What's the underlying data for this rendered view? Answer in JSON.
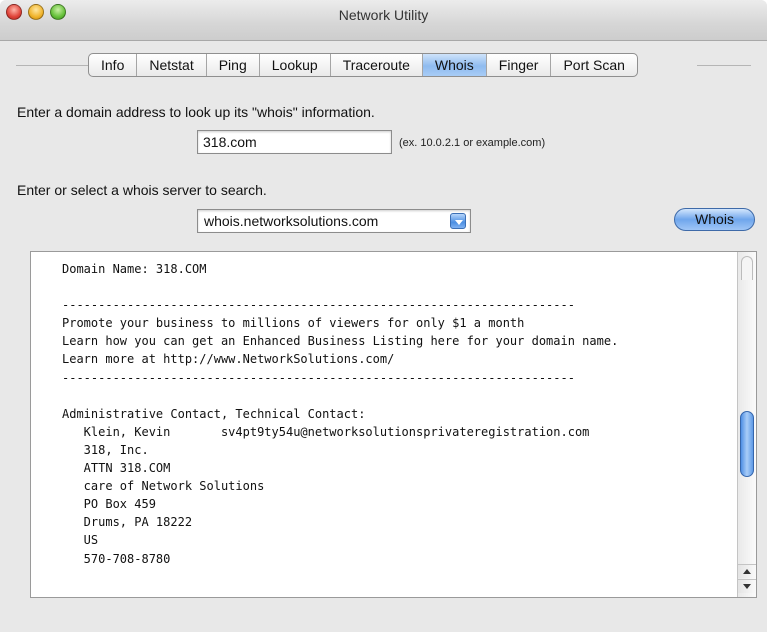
{
  "window": {
    "title": "Network Utility"
  },
  "tabs": [
    {
      "label": "Info"
    },
    {
      "label": "Netstat"
    },
    {
      "label": "Ping"
    },
    {
      "label": "Lookup"
    },
    {
      "label": "Traceroute"
    },
    {
      "label": "Whois",
      "active": true
    },
    {
      "label": "Finger"
    },
    {
      "label": "Port Scan"
    }
  ],
  "domain_prompt": "Enter a domain address to look up its \"whois\" information.",
  "domain_input": {
    "value": "318.com"
  },
  "domain_hint": "(ex. 10.0.2.1 or example.com)",
  "server_prompt": "Enter or select a whois server to search.",
  "server_select": {
    "value": "whois.networksolutions.com"
  },
  "whois_button": "Whois",
  "output_text": "Domain Name: 318.COM\n\n-----------------------------------------------------------------------\nPromote your business to millions of viewers for only $1 a month\nLearn how you can get an Enhanced Business Listing here for your domain name.\nLearn more at http://www.NetworkSolutions.com/\n-----------------------------------------------------------------------\n\nAdministrative Contact, Technical Contact:\n   Klein, Kevin       sv4pt9ty54u@networksolutionsprivateregistration.com\n   318, Inc.\n   ATTN 318.COM\n   care of Network Solutions\n   PO Box 459\n   Drums, PA 18222\n   US\n   570-708-8780",
  "scrollbar": {
    "position_fraction": 0.55
  },
  "colors": {
    "active_tab": "#8fbbef",
    "button_accent": "#6fa6ec",
    "window_bg": "#e8e8e8"
  }
}
